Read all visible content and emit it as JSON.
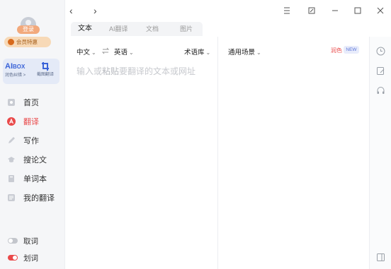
{
  "sidebar": {
    "login_label": "登录",
    "member_label": "会员特惠",
    "tools": [
      {
        "logo_main": "AI",
        "logo_suffix": "BOX",
        "label": "润色纠错 >"
      },
      {
        "label": "截图翻译"
      }
    ],
    "nav": [
      {
        "label": "首页",
        "icon": "home-icon",
        "active": false
      },
      {
        "label": "翻译",
        "icon": "translate-icon",
        "active": true
      },
      {
        "label": "写作",
        "icon": "write-icon",
        "active": false
      },
      {
        "label": "搜论文",
        "icon": "paper-icon",
        "active": false
      },
      {
        "label": "单词本",
        "icon": "wordbook-icon",
        "active": false
      },
      {
        "label": "我的翻译",
        "icon": "my-translation-icon",
        "active": false
      }
    ],
    "toggles": [
      {
        "label": "取词",
        "on": false
      },
      {
        "label": "划词",
        "on": true
      }
    ]
  },
  "topbar": {
    "tabs": [
      {
        "label": "文本",
        "active": true
      },
      {
        "label": "AI翻译",
        "active": false
      },
      {
        "label": "文档",
        "active": false
      },
      {
        "label": "图片",
        "active": false
      }
    ]
  },
  "source": {
    "from_lang": "中文",
    "to_lang": "英语",
    "term_bank": "术语库",
    "placeholder_prefix": "输入或",
    "placeholder_paste": "粘贴",
    "placeholder_rest": "要翻译的文本或网址"
  },
  "target": {
    "scene": "通用场景",
    "rewrite_label": "润色",
    "new_badge": "NEW"
  },
  "colors": {
    "accent": "#e9494a",
    "brand_blue": "#3a63d8",
    "sidebar_bg": "#f5f6f8",
    "toggle_on": "#e9494a",
    "toggle_off": "#c3c6cc"
  }
}
